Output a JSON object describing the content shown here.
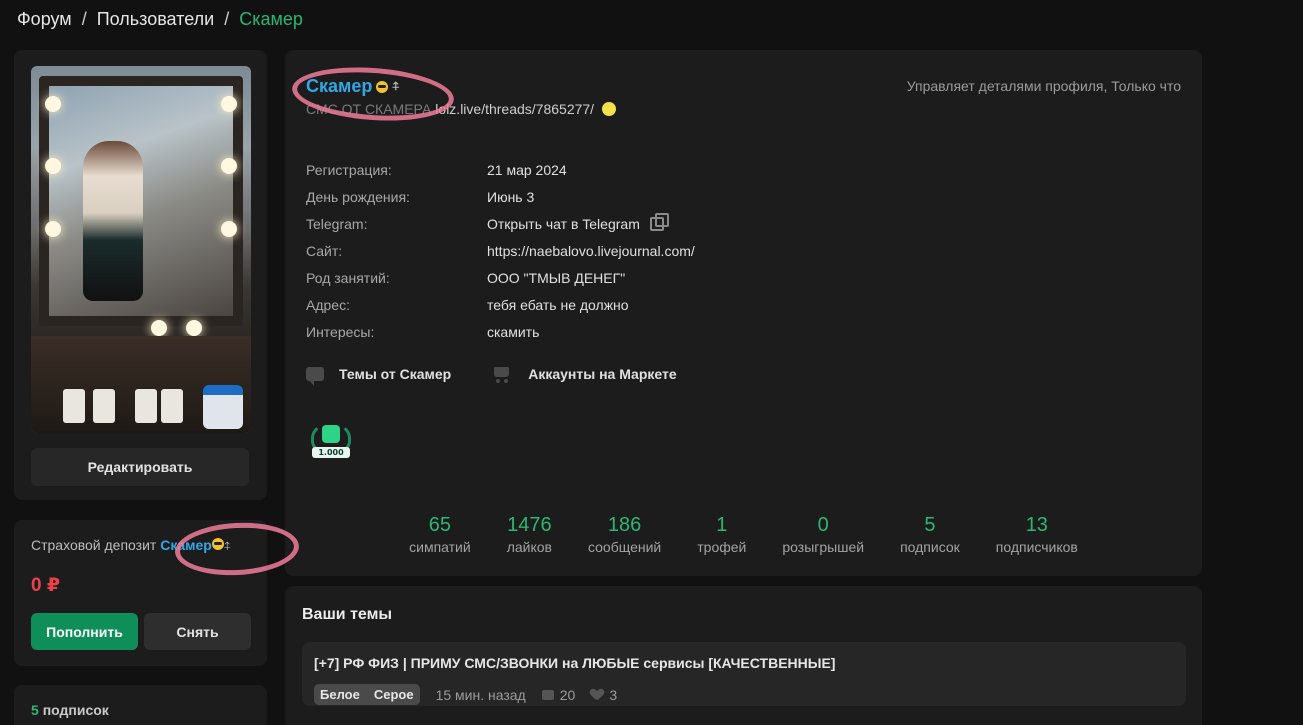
{
  "breadcrumb": {
    "items": [
      "Форум",
      "Пользователи",
      "Скамер"
    ],
    "separator": "/"
  },
  "sidebar": {
    "edit_button": "Редактировать",
    "deposit": {
      "title": "Страховой депозит",
      "username": "Скамер",
      "amount": "0 ₽",
      "deposit_button": "Пополнить",
      "withdraw_button": "Снять"
    },
    "subscriptions": {
      "count": "5",
      "label": "подписок"
    }
  },
  "profile": {
    "username": "Скамер",
    "status_prefix": "СМС ОТ СКАМЕРА",
    "status_link": "lolz.live/threads/7865277/",
    "activity": "Управляет деталями профиля, Только что",
    "info": [
      {
        "label": "Регистрация:",
        "value": "21 мар 2024"
      },
      {
        "label": "День рождения:",
        "value": "Июнь 3"
      },
      {
        "label": "Telegram:",
        "value": "Открыть чат в Telegram"
      },
      {
        "label": "Сайт:",
        "value": "https://naebalovo.livejournal.com/"
      },
      {
        "label": "Род занятий:",
        "value": "ООО \"ТМЫВ ДЕНЕГ\""
      },
      {
        "label": "Адрес:",
        "value": "тебя ебать не должно"
      },
      {
        "label": "Интересы:",
        "value": "скамить"
      }
    ],
    "links": {
      "topics": "Темы от Скамер",
      "market": "Аккаунты на Маркете"
    },
    "trophy_label": "1.000",
    "stats": [
      {
        "value": "65",
        "label": "симпатий"
      },
      {
        "value": "1476",
        "label": "лайков"
      },
      {
        "value": "186",
        "label": "сообщений"
      },
      {
        "value": "1",
        "label": "трофей"
      },
      {
        "value": "0",
        "label": "розыгрышей"
      },
      {
        "value": "5",
        "label": "подписок"
      },
      {
        "value": "13",
        "label": "подписчиков"
      }
    ]
  },
  "topics": {
    "title": "Ваши темы",
    "items": [
      {
        "title": "[+7] РФ ФИЗ | ПРИМУ СМС/ЗВОНКИ на ЛЮБЫЕ сервисы [КАЧЕСТВЕННЫЕ]",
        "tags": [
          "Белое",
          "Серое"
        ],
        "time": "15 мин. назад",
        "replies": "20",
        "likes": "3"
      }
    ]
  },
  "colors": {
    "accent_green": "#2bb673",
    "username_blue": "#2fa8e6",
    "highlight_pink": "#f07d9a",
    "danger_red": "#e9424a"
  }
}
